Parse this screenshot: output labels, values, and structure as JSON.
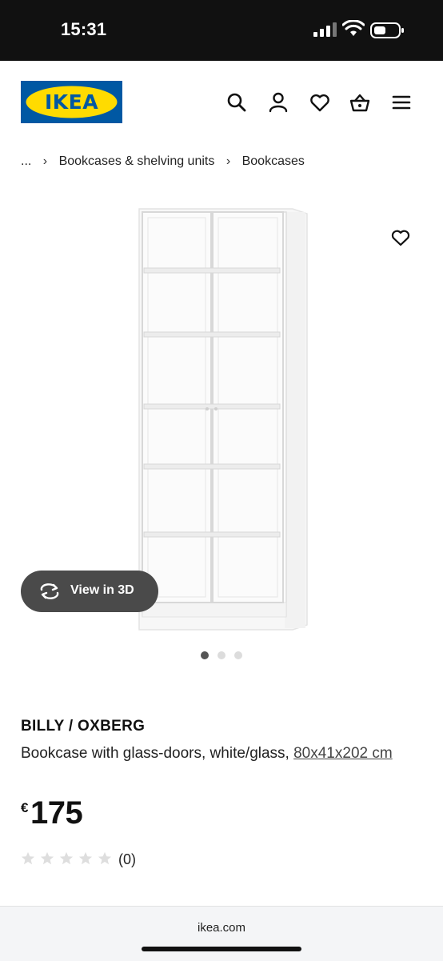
{
  "status_bar": {
    "time": "15:31"
  },
  "header": {
    "logo_text": "IKEA",
    "icons": [
      "search-icon",
      "profile-icon",
      "wishlist-heart-icon",
      "shopping-bag-icon",
      "menu-icon"
    ]
  },
  "breadcrumb": {
    "ellipsis": "...",
    "items": [
      "Bookcases & shelving units",
      "Bookcases"
    ]
  },
  "gallery": {
    "view_3d_label": "View in 3D",
    "image_count": 3,
    "active_index": 0
  },
  "product": {
    "name": "BILLY / OXBERG",
    "description": "Bookcase with glass-doors, white/glass,",
    "dimensions": "80x41x202 cm",
    "currency": "€",
    "price": "175",
    "rating_value": 0,
    "rating_max": 5,
    "review_count": "(0)"
  },
  "browser": {
    "url": "ikea.com"
  },
  "colors": {
    "brand_blue": "#0058a3",
    "brand_yellow": "#ffdb00",
    "pill_bg": "#4a4a4a"
  }
}
